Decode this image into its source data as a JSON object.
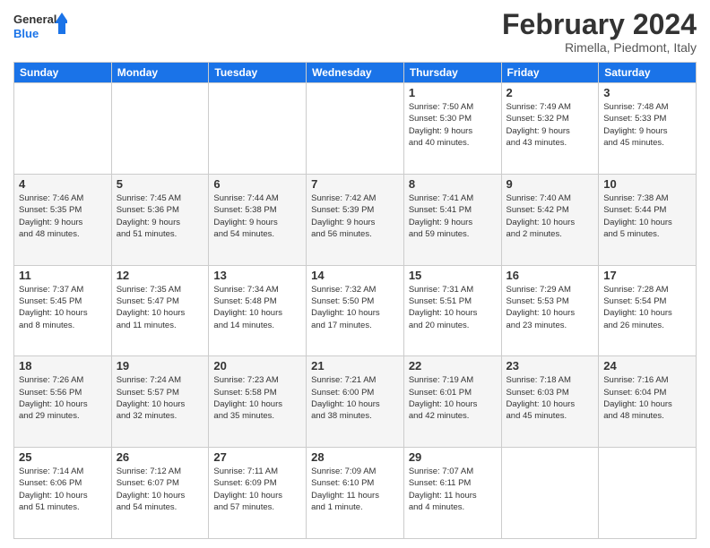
{
  "logo": {
    "line1": "General",
    "line2": "Blue"
  },
  "header": {
    "title": "February 2024",
    "subtitle": "Rimella, Piedmont, Italy"
  },
  "weekdays": [
    "Sunday",
    "Monday",
    "Tuesday",
    "Wednesday",
    "Thursday",
    "Friday",
    "Saturday"
  ],
  "weeks": [
    [
      {
        "day": "",
        "info": ""
      },
      {
        "day": "",
        "info": ""
      },
      {
        "day": "",
        "info": ""
      },
      {
        "day": "",
        "info": ""
      },
      {
        "day": "1",
        "info": "Sunrise: 7:50 AM\nSunset: 5:30 PM\nDaylight: 9 hours\nand 40 minutes."
      },
      {
        "day": "2",
        "info": "Sunrise: 7:49 AM\nSunset: 5:32 PM\nDaylight: 9 hours\nand 43 minutes."
      },
      {
        "day": "3",
        "info": "Sunrise: 7:48 AM\nSunset: 5:33 PM\nDaylight: 9 hours\nand 45 minutes."
      }
    ],
    [
      {
        "day": "4",
        "info": "Sunrise: 7:46 AM\nSunset: 5:35 PM\nDaylight: 9 hours\nand 48 minutes."
      },
      {
        "day": "5",
        "info": "Sunrise: 7:45 AM\nSunset: 5:36 PM\nDaylight: 9 hours\nand 51 minutes."
      },
      {
        "day": "6",
        "info": "Sunrise: 7:44 AM\nSunset: 5:38 PM\nDaylight: 9 hours\nand 54 minutes."
      },
      {
        "day": "7",
        "info": "Sunrise: 7:42 AM\nSunset: 5:39 PM\nDaylight: 9 hours\nand 56 minutes."
      },
      {
        "day": "8",
        "info": "Sunrise: 7:41 AM\nSunset: 5:41 PM\nDaylight: 9 hours\nand 59 minutes."
      },
      {
        "day": "9",
        "info": "Sunrise: 7:40 AM\nSunset: 5:42 PM\nDaylight: 10 hours\nand 2 minutes."
      },
      {
        "day": "10",
        "info": "Sunrise: 7:38 AM\nSunset: 5:44 PM\nDaylight: 10 hours\nand 5 minutes."
      }
    ],
    [
      {
        "day": "11",
        "info": "Sunrise: 7:37 AM\nSunset: 5:45 PM\nDaylight: 10 hours\nand 8 minutes."
      },
      {
        "day": "12",
        "info": "Sunrise: 7:35 AM\nSunset: 5:47 PM\nDaylight: 10 hours\nand 11 minutes."
      },
      {
        "day": "13",
        "info": "Sunrise: 7:34 AM\nSunset: 5:48 PM\nDaylight: 10 hours\nand 14 minutes."
      },
      {
        "day": "14",
        "info": "Sunrise: 7:32 AM\nSunset: 5:50 PM\nDaylight: 10 hours\nand 17 minutes."
      },
      {
        "day": "15",
        "info": "Sunrise: 7:31 AM\nSunset: 5:51 PM\nDaylight: 10 hours\nand 20 minutes."
      },
      {
        "day": "16",
        "info": "Sunrise: 7:29 AM\nSunset: 5:53 PM\nDaylight: 10 hours\nand 23 minutes."
      },
      {
        "day": "17",
        "info": "Sunrise: 7:28 AM\nSunset: 5:54 PM\nDaylight: 10 hours\nand 26 minutes."
      }
    ],
    [
      {
        "day": "18",
        "info": "Sunrise: 7:26 AM\nSunset: 5:56 PM\nDaylight: 10 hours\nand 29 minutes."
      },
      {
        "day": "19",
        "info": "Sunrise: 7:24 AM\nSunset: 5:57 PM\nDaylight: 10 hours\nand 32 minutes."
      },
      {
        "day": "20",
        "info": "Sunrise: 7:23 AM\nSunset: 5:58 PM\nDaylight: 10 hours\nand 35 minutes."
      },
      {
        "day": "21",
        "info": "Sunrise: 7:21 AM\nSunset: 6:00 PM\nDaylight: 10 hours\nand 38 minutes."
      },
      {
        "day": "22",
        "info": "Sunrise: 7:19 AM\nSunset: 6:01 PM\nDaylight: 10 hours\nand 42 minutes."
      },
      {
        "day": "23",
        "info": "Sunrise: 7:18 AM\nSunset: 6:03 PM\nDaylight: 10 hours\nand 45 minutes."
      },
      {
        "day": "24",
        "info": "Sunrise: 7:16 AM\nSunset: 6:04 PM\nDaylight: 10 hours\nand 48 minutes."
      }
    ],
    [
      {
        "day": "25",
        "info": "Sunrise: 7:14 AM\nSunset: 6:06 PM\nDaylight: 10 hours\nand 51 minutes."
      },
      {
        "day": "26",
        "info": "Sunrise: 7:12 AM\nSunset: 6:07 PM\nDaylight: 10 hours\nand 54 minutes."
      },
      {
        "day": "27",
        "info": "Sunrise: 7:11 AM\nSunset: 6:09 PM\nDaylight: 10 hours\nand 57 minutes."
      },
      {
        "day": "28",
        "info": "Sunrise: 7:09 AM\nSunset: 6:10 PM\nDaylight: 11 hours\nand 1 minute."
      },
      {
        "day": "29",
        "info": "Sunrise: 7:07 AM\nSunset: 6:11 PM\nDaylight: 11 hours\nand 4 minutes."
      },
      {
        "day": "",
        "info": ""
      },
      {
        "day": "",
        "info": ""
      }
    ]
  ]
}
